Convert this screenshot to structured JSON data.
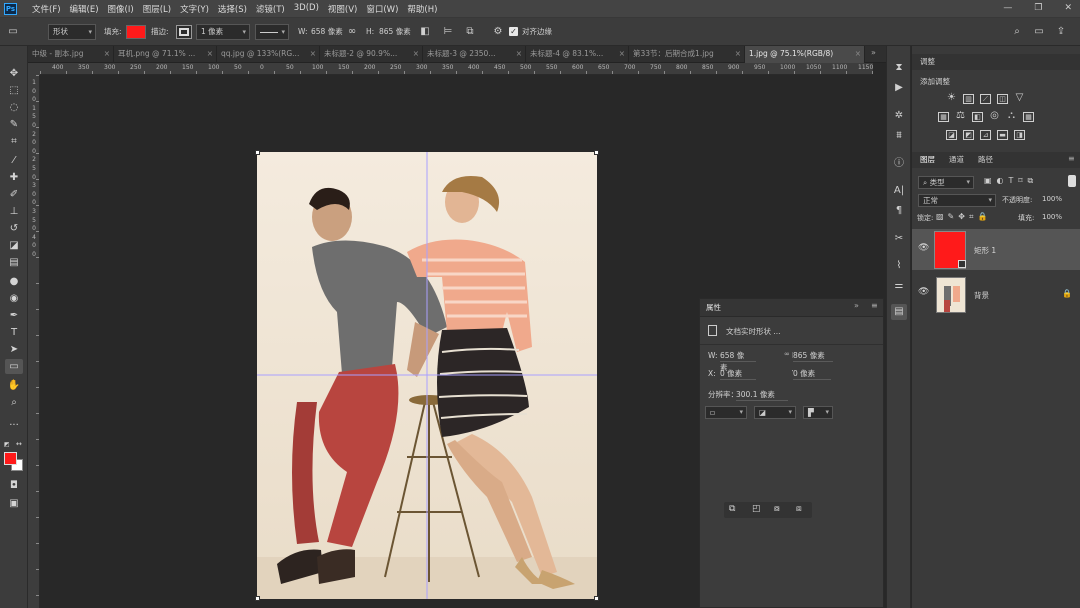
{
  "menubar": {
    "logo": "Ps",
    "items": [
      "文件(F)",
      "编辑(E)",
      "图像(I)",
      "图层(L)",
      "文字(Y)",
      "选择(S)",
      "滤镜(T)",
      "3D(D)",
      "视图(V)",
      "窗口(W)",
      "帮助(H)"
    ]
  },
  "options": {
    "mode": "形状",
    "fill_label": "填充:",
    "fill_color": "#ff1a1a",
    "stroke_label": "描边:",
    "stroke_width": "1 像素",
    "w_label": "W:",
    "w_value": "658 像素",
    "h_label": "H:",
    "h_value": "865 像素",
    "align_edges": "对齐边缘"
  },
  "tabs": [
    "中级 - 副本.jpg",
    "耳机.png @ 71.1% ...",
    "qq.jpg @ 133%(RG...",
    "未标题-2 @ 90.9%...",
    "未标题-3 @ 2350...",
    "未标题-4 @ 83.1%...",
    "第33节：后期合成1.jpg",
    "1.jpg @ 75.1%(RGB/8)"
  ],
  "ruler_h": [
    "400",
    "350",
    "300",
    "250",
    "200",
    "150",
    "100",
    "50",
    "0",
    "50",
    "100",
    "150",
    "200",
    "250",
    "300",
    "350",
    "400",
    "450",
    "500",
    "550",
    "600",
    "650",
    "700",
    "750",
    "800",
    "850",
    "900",
    "950",
    "1000",
    "1050",
    "1100",
    "1150"
  ],
  "ruler_v": [
    "1",
    "0",
    "0",
    "1",
    "5",
    "0",
    "2",
    "0",
    "0",
    "2",
    "5",
    "0",
    "3",
    "0",
    "0",
    "3",
    "5",
    "0",
    "4",
    "0",
    "0"
  ],
  "adjustments": {
    "tab": "调整",
    "title": "添加调整"
  },
  "layers_panel": {
    "tabs": [
      "图层",
      "通道",
      "路径"
    ],
    "filter": "类型",
    "blend_mode": "正常",
    "opacity_label": "不透明度:",
    "opacity": "100%",
    "lock_label": "锁定:",
    "fill_label": "填充:",
    "fill": "100%",
    "layers": [
      {
        "name": "矩形 1",
        "color": "#ff1a1a"
      },
      {
        "name": "背景"
      }
    ]
  },
  "properties": {
    "title": "属性",
    "kind": "文档实时形状 ...",
    "w_label": "W:",
    "w": "658 像素",
    "h_label": "H:",
    "h": "865 像素",
    "x_label": "X:",
    "x": "0 像素",
    "y_label": "Y:",
    "y": "0 像素",
    "resolution_label": "分辨率：",
    "resolution": "300.1 像素"
  },
  "colors": {
    "foreground": "#ff1a1a",
    "background": "#ffffff"
  }
}
